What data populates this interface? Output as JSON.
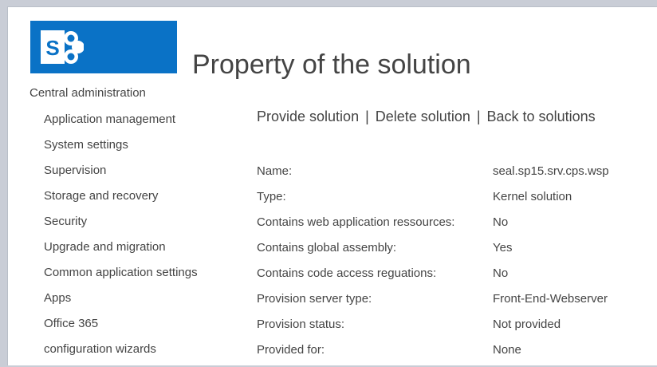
{
  "page": {
    "title": "Property of the solution"
  },
  "logo": {
    "letter": "S"
  },
  "sidebar": {
    "heading": "Central administration",
    "items": [
      {
        "label": "Application management"
      },
      {
        "label": "System settings"
      },
      {
        "label": "Supervision"
      },
      {
        "label": "Storage and recovery"
      },
      {
        "label": "Security"
      },
      {
        "label": "Upgrade and migration"
      },
      {
        "label": "Common application settings"
      },
      {
        "label": "Apps"
      },
      {
        "label": "Office 365"
      },
      {
        "label": "configuration wizards"
      }
    ]
  },
  "actions": {
    "provide": "Provide solution",
    "delete": "Delete solution",
    "back": "Back to solutions",
    "separator": "|"
  },
  "properties": [
    {
      "label": "Name:",
      "value": "seal.sp15.srv.cps.wsp"
    },
    {
      "label": "Type:",
      "value": "Kernel solution"
    },
    {
      "label": "Contains web application ressources:",
      "value": "No"
    },
    {
      "label": "Contains global assembly:",
      "value": "Yes"
    },
    {
      "label": "Contains code access reguations:",
      "value": "No"
    },
    {
      "label": "Provision server type:",
      "value": "Front-End-Webserver"
    },
    {
      "label": "Provision status:",
      "value": "Not provided"
    },
    {
      "label": "Provided for:",
      "value": "None"
    }
  ],
  "colors": {
    "brand": "#0a72c6",
    "text": "#444444",
    "background": "#ffffff"
  }
}
